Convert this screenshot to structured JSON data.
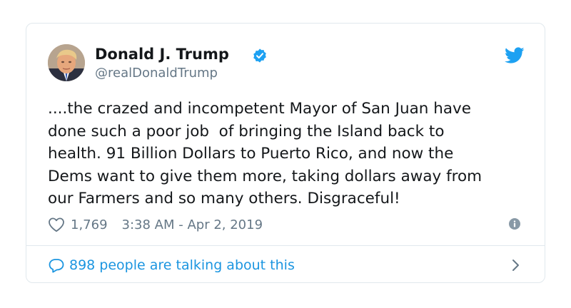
{
  "tweet": {
    "author": {
      "display_name": "Donald J. Trump",
      "handle": "@realDonaldTrump",
      "verified": true
    },
    "text": "....the crazed and incompetent Mayor of San Juan have\ndone such a poor job  of bringing the Island back to\nhealth. 91 Billion Dollars to Puerto Rico, and now the\nDems want to give them more, taking dollars away from\nour Farmers and so many others. Disgraceful!",
    "likes": "1,769",
    "timestamp": "3:38 AM - Apr 2, 2019",
    "conversation_label": "898 people are talking about this"
  },
  "icons": {
    "brand": "twitter-bird-icon",
    "verified": "verified-badge-icon",
    "like": "heart-icon",
    "info": "info-icon",
    "reply": "speech-bubble-icon",
    "more": "chevron-right-icon"
  },
  "colors": {
    "accent": "#1da1f2",
    "link": "#1b95e0",
    "secondary_text": "#657786",
    "border": "#e1e8ed"
  }
}
